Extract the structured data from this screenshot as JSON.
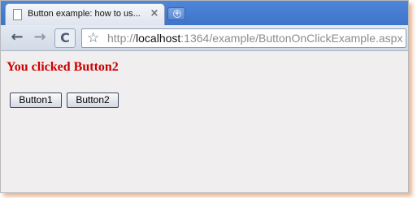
{
  "browser": {
    "tab": {
      "title": "Button example: how to us...",
      "close_glyph": "×",
      "icon": "page-icon"
    },
    "new_tab": {
      "glyph": "+",
      "icon": "new-tab-icon"
    },
    "toolbar": {
      "back_glyph": "←",
      "forward_glyph": "→",
      "reload_glyph": "C",
      "star_glyph": "☆"
    },
    "address": {
      "scheme": "http://",
      "host": "localhost",
      "path": ":1364/example/ButtonOnClickExample.aspx"
    }
  },
  "page": {
    "message": "You clicked Button2",
    "message_color": "#cc0000",
    "buttons": [
      {
        "label": "Button1"
      },
      {
        "label": "Button2"
      }
    ]
  }
}
